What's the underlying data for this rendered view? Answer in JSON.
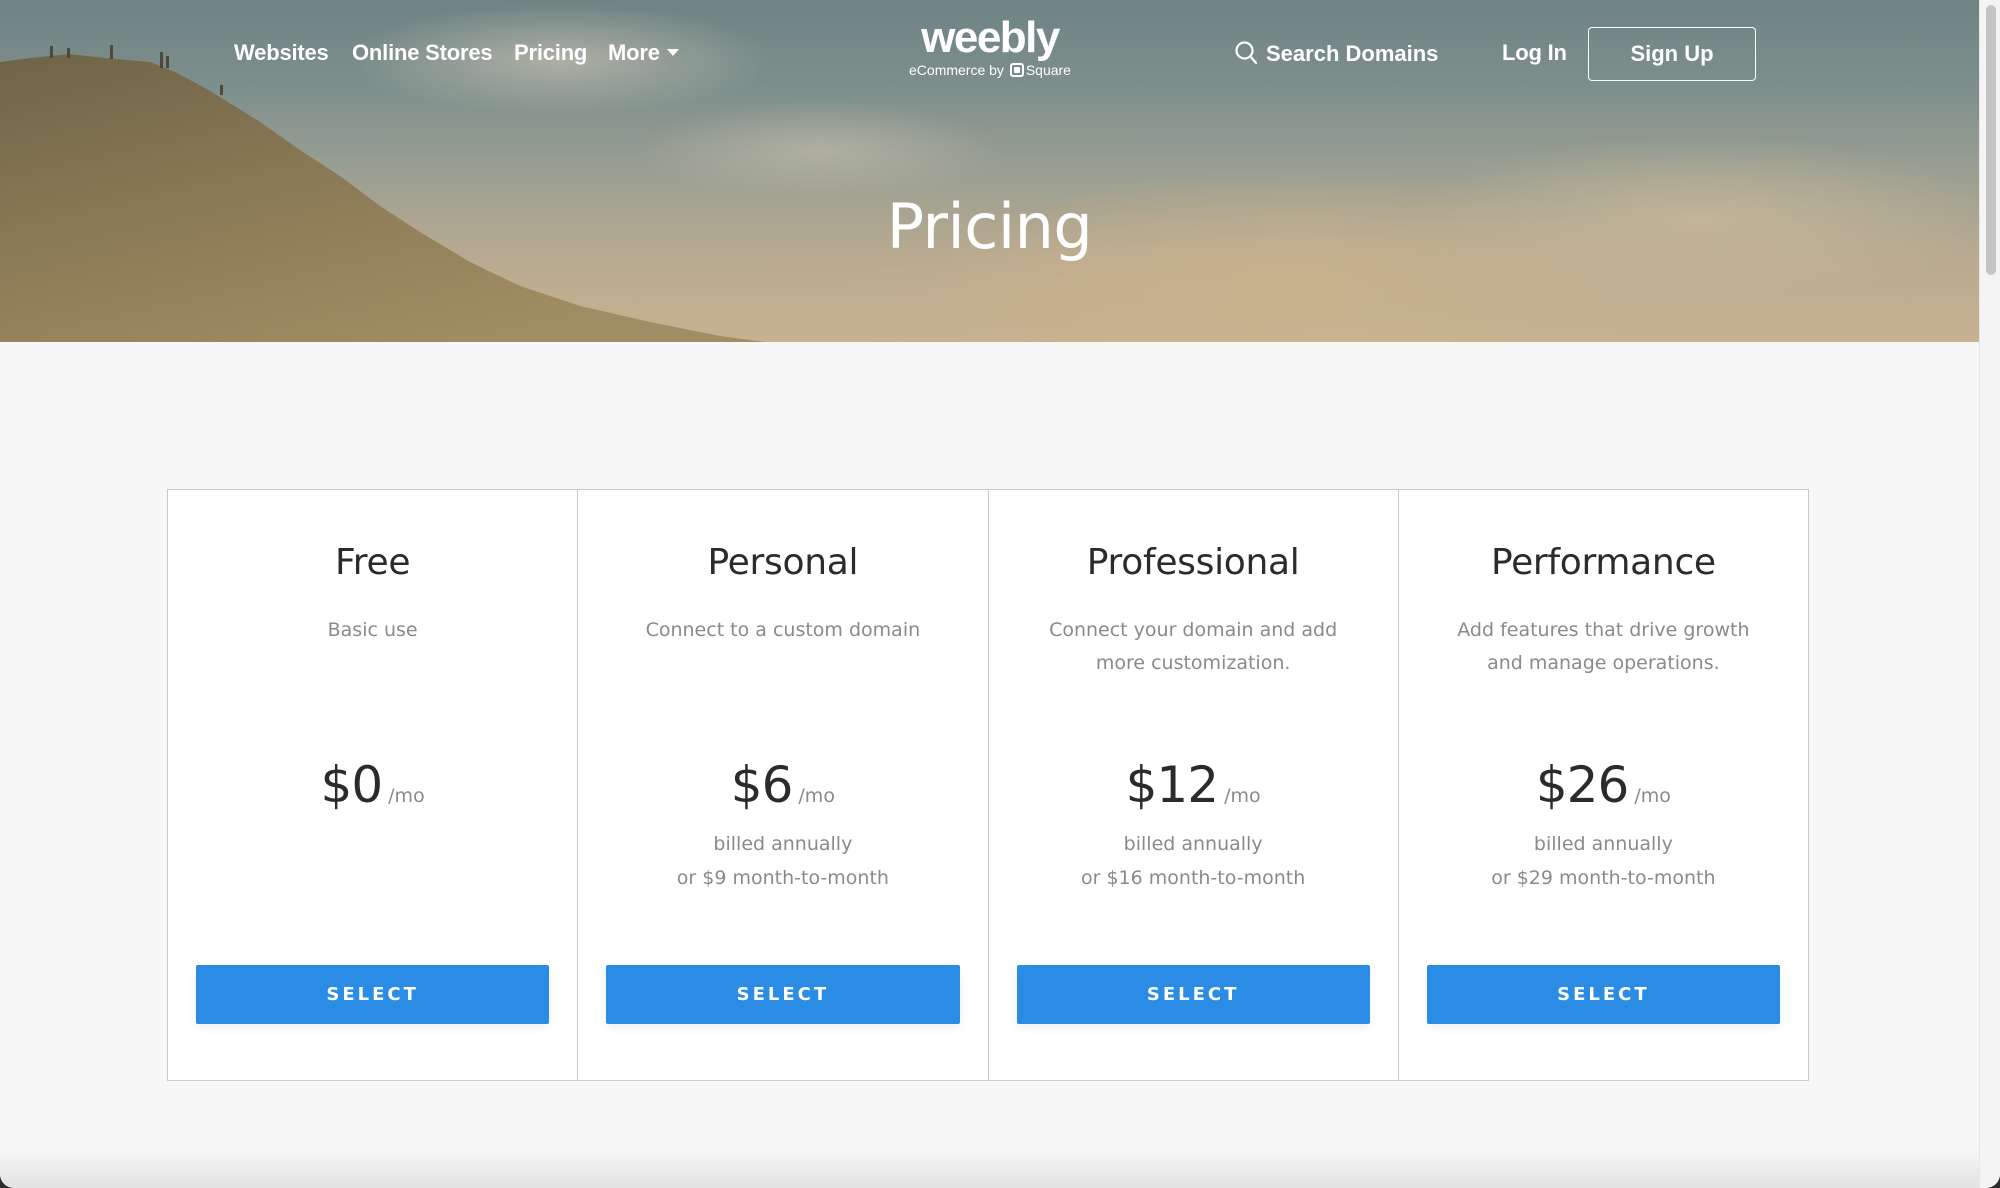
{
  "nav": {
    "links": [
      {
        "label": "Websites"
      },
      {
        "label": "Online Stores"
      },
      {
        "label": "Pricing"
      },
      {
        "label": "More",
        "has_dropdown": true
      }
    ],
    "logo": {
      "wordmark": "weebly",
      "tagline_prefix": "eCommerce by",
      "tagline_brand": "Square"
    },
    "search_label": "Search Domains",
    "login_label": "Log In",
    "signup_label": "Sign Up"
  },
  "hero": {
    "title": "Pricing"
  },
  "colors": {
    "accent": "#2a8ce5",
    "heading_text": "#2b2b2b",
    "muted_text": "#8a8a8a",
    "page_background": "#f7f7f7",
    "card_border": "#c9c9c9"
  },
  "icons": {
    "search": "search-icon",
    "dropdown": "caret-down-icon",
    "square_logo": "square-logo-icon"
  },
  "plans": [
    {
      "name": "Free",
      "description": "Basic use",
      "price": "$0",
      "per": "/mo",
      "billing_line1": "",
      "billing_line2": "",
      "button_label": "SELECT"
    },
    {
      "name": "Personal",
      "description": "Connect to a custom domain",
      "price": "$6",
      "per": "/mo",
      "billing_line1": "billed annually",
      "billing_line2": "or $9 month-to-month",
      "button_label": "SELECT"
    },
    {
      "name": "Professional",
      "description": "Connect your domain and add more customization.",
      "price": "$12",
      "per": "/mo",
      "billing_line1": "billed annually",
      "billing_line2": "or $16 month-to-month",
      "button_label": "SELECT"
    },
    {
      "name": "Performance",
      "description": "Add features that drive growth and manage operations.",
      "price": "$26",
      "per": "/mo",
      "billing_line1": "billed annually",
      "billing_line2": "or $29 month-to-month",
      "button_label": "SELECT"
    }
  ]
}
